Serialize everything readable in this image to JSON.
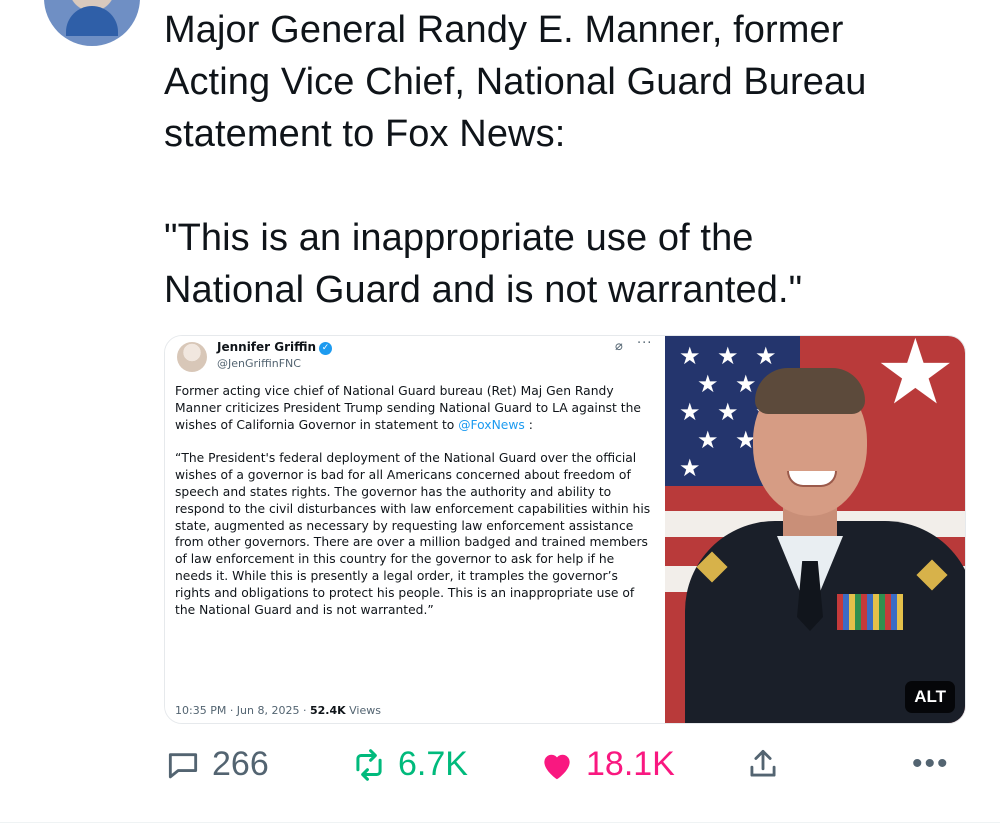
{
  "post": {
    "text": "Major General Randy E. Manner, former\nActing Vice Chief, National Guard Bureau\nstatement to Fox News:\n\n\"This is an inappropriate use of the\nNational Guard and is not warranted.\""
  },
  "embedded_tweet": {
    "name": "Jennifer Griffin",
    "handle": "@JenGriffinFNC",
    "verified_glyph": "✓",
    "grok_glyph": "⌀",
    "more_glyph": "···",
    "intro": "Former acting vice chief of National Guard bureau (Ret) Maj Gen Randy Manner criticizes President Trump sending National Guard to LA against the wishes of California Governor in statement to ",
    "mention": "@FoxNews",
    "intro_end": " :",
    "quote": "“The President's federal deployment of the National Guard over the official wishes of a governor is bad for all Americans concerned about freedom of speech and states rights. The governor has the authority and ability to respond to the civil disturbances with law enforcement capabilities within his state, augmented as necessary by requesting law enforcement assistance from other governors. There are over a million badged and trained members of law enforcement in this country for the governor to ask for help if he needs it. While this is presently a legal order, it tramples the governor’s rights and obligations to protect his people. This is an inappropriate use of the National Guard and is not warranted.”",
    "timestamp": "10:35 PM · Jun 8, 2025 · ",
    "views_count": "52.4K",
    "views_label": " Views"
  },
  "photo": {
    "alt_label": "ALT"
  },
  "actions": {
    "replies": "266",
    "reposts": "6.7K",
    "likes": "18.1K",
    "more": "•••"
  },
  "colors": {
    "text": "#0f1419",
    "muted": "#536471",
    "link": "#1d9bf0",
    "repost": "#00ba7c",
    "like": "#f91880"
  },
  "icons": {
    "reply": "reply-icon",
    "repost": "repost-icon",
    "like": "heart-icon",
    "share": "share-icon",
    "more": "more-icon"
  }
}
